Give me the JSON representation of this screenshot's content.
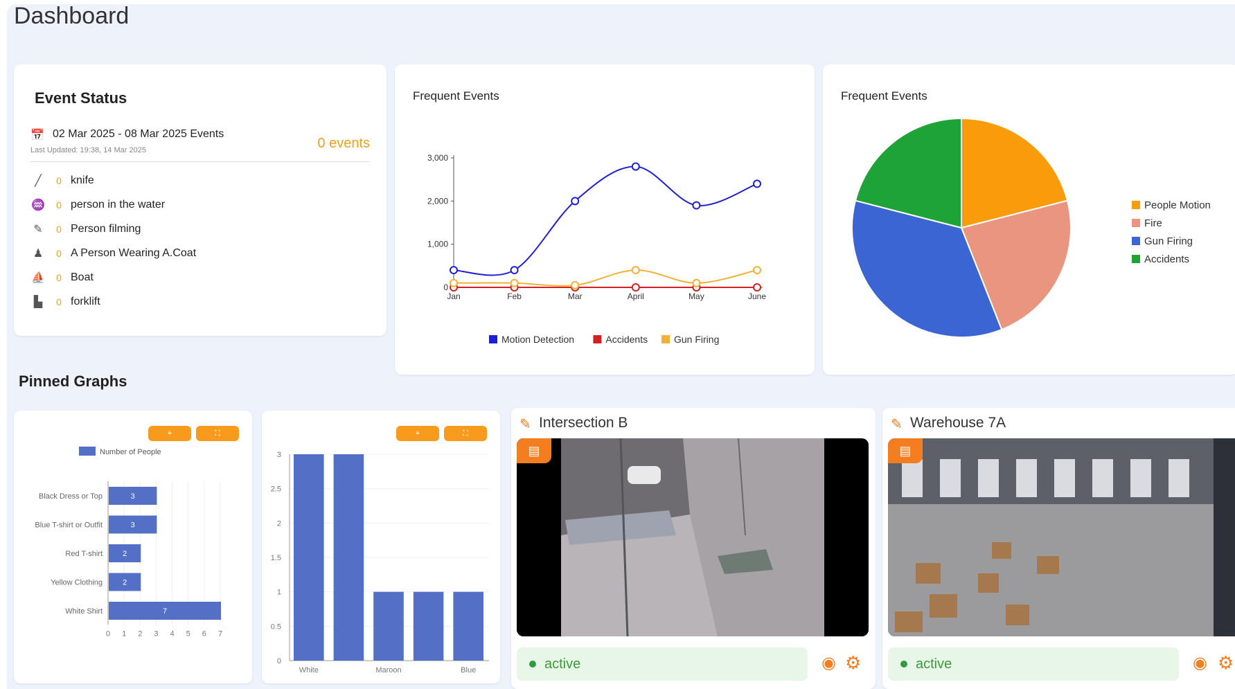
{
  "page": {
    "title": "Dashboard"
  },
  "event_status": {
    "title": "Event Status",
    "range": "02 Mar 2025 - 08 Mar 2025 Events",
    "updated": "Last Updated: 19:38, 14 Mar 2025",
    "count": "0 events",
    "items": [
      {
        "icon": "knife-icon",
        "glyph": "╱",
        "count": "0",
        "label": "knife"
      },
      {
        "icon": "water-person-icon",
        "glyph": "♒",
        "count": "0",
        "label": "person in the water"
      },
      {
        "icon": "camera-person-icon",
        "glyph": "✎",
        "count": "0",
        "label": "Person filming"
      },
      {
        "icon": "coat-person-icon",
        "glyph": "♟",
        "count": "0",
        "label": "A Person Wearing A.Coat"
      },
      {
        "icon": "boat-icon",
        "glyph": "⛵",
        "count": "0",
        "label": "Boat"
      },
      {
        "icon": "forklift-icon",
        "glyph": "▙",
        "count": "0",
        "label": "forklift"
      }
    ]
  },
  "line_card": {
    "title": "Frequent Events"
  },
  "pie_card": {
    "title": "Frequent Events"
  },
  "pinned": {
    "title": "Pinned Graphs",
    "pin_label": "⌖",
    "expand_label": "⛶"
  },
  "cameras": [
    {
      "title": "Intersection B",
      "status": "active"
    },
    {
      "title": "Warehouse 7A",
      "status": "active"
    }
  ],
  "chart_data": [
    {
      "type": "line",
      "title": "Frequent Events",
      "x": [
        "Jan",
        "Feb",
        "Mar",
        "April",
        "May",
        "June"
      ],
      "ylim": [
        0,
        3000
      ],
      "yticks": [
        "0",
        "1,000",
        "2,000",
        "3,000"
      ],
      "series": [
        {
          "name": "Motion Detection",
          "color": "#1f1fd6",
          "values": [
            400,
            400,
            2000,
            2800,
            1900,
            2400
          ]
        },
        {
          "name": "Accidents",
          "color": "#d62020",
          "values": [
            0,
            0,
            0,
            0,
            0,
            0
          ]
        },
        {
          "name": "Gun Firing",
          "color": "#f2b134",
          "values": [
            100,
            100,
            50,
            400,
            100,
            400
          ]
        }
      ],
      "legend": "bottom",
      "grid": false
    },
    {
      "type": "pie",
      "title": "Frequent Events",
      "categories": [
        "People Motion",
        "Fire",
        "Gun Firing",
        "Accidents"
      ],
      "values": [
        21,
        23,
        35,
        21
      ],
      "colors": [
        "#f89c0c",
        "#e99580",
        "#3a65d2",
        "#1ea336"
      ],
      "legend": "right"
    },
    {
      "type": "bar",
      "orientation": "horizontal",
      "categories": [
        "Black Dress or Top",
        "Blue T-shirt or Outfit",
        "Red T-shirt",
        "Yellow Clothing",
        "White Shirt"
      ],
      "series": [
        {
          "name": "Number of People",
          "values": [
            3,
            3,
            2,
            2,
            7
          ]
        }
      ],
      "xlim": [
        0,
        7
      ],
      "xticks": [
        "0",
        "1",
        "2",
        "3",
        "4",
        "5",
        "6",
        "7"
      ],
      "color": "#5470c6",
      "legend": "top"
    },
    {
      "type": "bar",
      "categories": [
        "White",
        "",
        "Maroon",
        "",
        "Blue"
      ],
      "values": [
        3,
        3,
        1,
        1,
        1
      ],
      "ylim": [
        0,
        3
      ],
      "yticks": [
        "0",
        "0.5",
        "1",
        "1.5",
        "2",
        "2.5",
        "3"
      ],
      "color": "#5470c6"
    }
  ]
}
